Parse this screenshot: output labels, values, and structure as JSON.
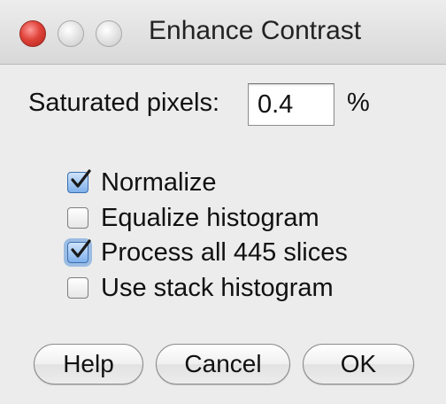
{
  "window": {
    "title": "Enhance Contrast",
    "controls": [
      "close-icon",
      "minimize-icon",
      "zoom-icon"
    ]
  },
  "form": {
    "saturated_label": "Saturated pixels:",
    "saturated_value": "0.4",
    "saturated_unit": "%"
  },
  "options": [
    {
      "label": "Normalize",
      "checked": true
    },
    {
      "label": "Equalize histogram",
      "checked": false
    },
    {
      "label": "Process all 445 slices",
      "checked": true
    },
    {
      "label": "Use stack histogram",
      "checked": false
    }
  ],
  "buttons": {
    "help": "Help",
    "cancel": "Cancel",
    "ok": "OK"
  },
  "colors": {
    "window_bg": "#ececec",
    "close_red": "#e0443a",
    "check_blue": "#3a6fb0"
  }
}
